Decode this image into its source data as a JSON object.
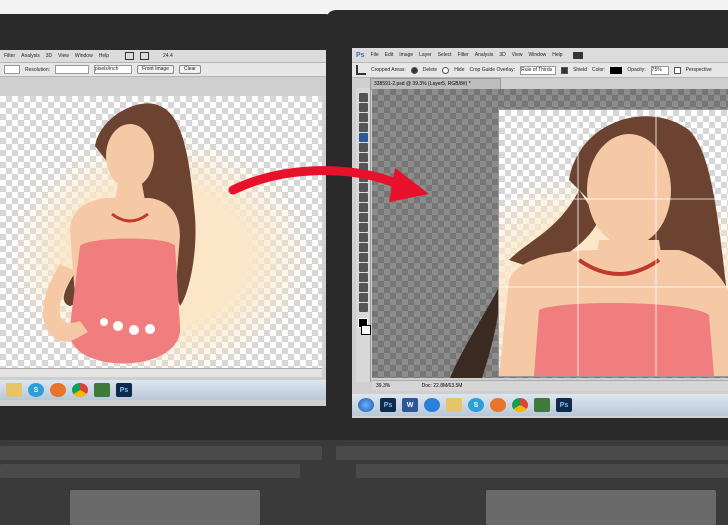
{
  "left_screen": {
    "menu": [
      "Filter",
      "Analysis",
      "3D",
      "View",
      "Window",
      "Help"
    ],
    "zoom": "24.4",
    "options": {
      "resolution_label": "Resolution:",
      "units": "pixels/inch",
      "front_image_button": "Front Image",
      "clear_button": "Clear"
    },
    "taskbar_ps": "Ps"
  },
  "right_screen": {
    "app_logo": "Ps",
    "menu": [
      "File",
      "Edit",
      "Image",
      "Layer",
      "Select",
      "Filter",
      "Analysis",
      "3D",
      "View",
      "Window",
      "Help"
    ],
    "options": {
      "cropped_areas_label": "Cropped Areas:",
      "delete_label": "Delete",
      "hide_label": "Hide",
      "crop_guide_label": "Crop Guide Overlay:",
      "crop_guide_value": "Rule of Thirds",
      "shield_label": "Shield",
      "color_label": "Color:",
      "opacity_label": "Opacity:",
      "opacity_value": "75%",
      "perspective_label": "Perspective"
    },
    "document_tab": "338591-2.psd @ 39.3% (Layer5, RGB/8#) *",
    "status": {
      "zoom": "39.3%",
      "doc": "Doc: 22.8M/63.5M"
    },
    "taskbar_ps": "Ps",
    "taskbar_w": "W"
  },
  "colors": {
    "arrow": "#e8102a",
    "dress": "#f07e7e",
    "hair": "#6b4330",
    "skin": "#f6c9a6"
  }
}
